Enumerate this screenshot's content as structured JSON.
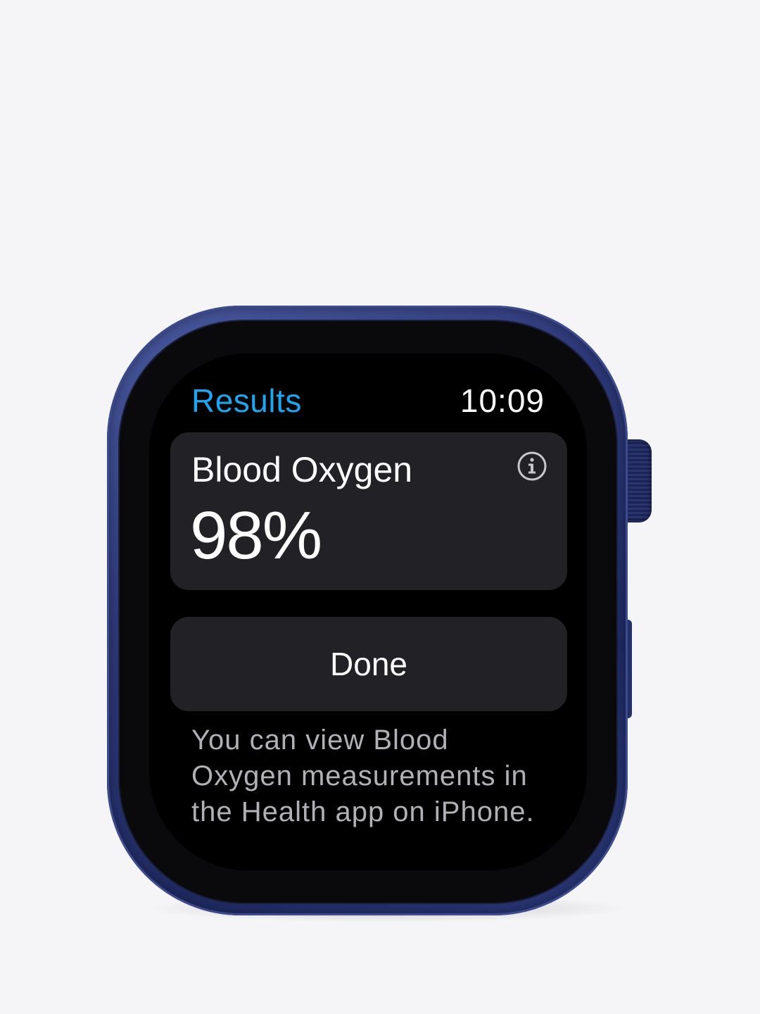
{
  "header": {
    "title": "Results",
    "time": "10:09"
  },
  "card": {
    "title": "Blood Oxygen",
    "value": "98%",
    "info_icon": "info-icon"
  },
  "actions": {
    "done_label": "Done"
  },
  "footnote": {
    "text": "You can view Blood Oxygen measurements in the Health app on iPhone."
  },
  "colors": {
    "accent": "#1ea5f0",
    "case": "#2e3a7a",
    "card_bg": "#222226",
    "background": "#f5f5f7"
  }
}
